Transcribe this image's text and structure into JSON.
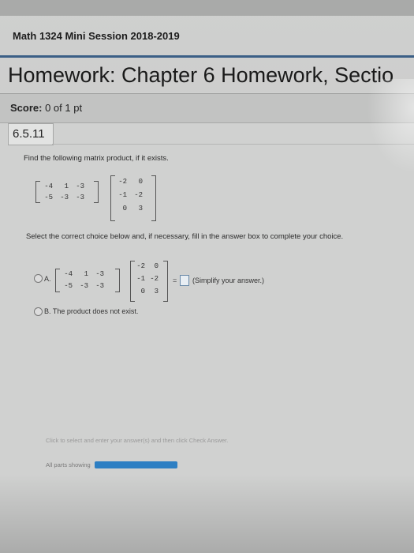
{
  "course": "Math 1324 Mini Session 2018-2019",
  "homework_title": "Homework: Chapter 6 Homework, Sectio",
  "score": {
    "label": "Score:",
    "value": "0 of 1 pt"
  },
  "question_id": "6.5.11",
  "prompt": "Find the following matrix product, if it exists.",
  "matrix_a": [
    [
      "-4",
      "1",
      "-3"
    ],
    [
      "-5",
      "-3",
      "-3"
    ]
  ],
  "matrix_b": [
    [
      "-2",
      "0"
    ],
    [
      "-1",
      "-2"
    ],
    [
      "0",
      "3"
    ]
  ],
  "select_instruction": "Select the correct choice below and, if necessary, fill in the answer box to complete your choice.",
  "option_a": {
    "letter": "A.",
    "equals": "=",
    "hint": "(Simplify your answer.)"
  },
  "option_b": {
    "text": "B.  The product does not exist."
  },
  "footer_hint": "Click to select and enter your answer(s) and then click Check Answer.",
  "all_parts": "All parts showing",
  "progress": 1.0
}
